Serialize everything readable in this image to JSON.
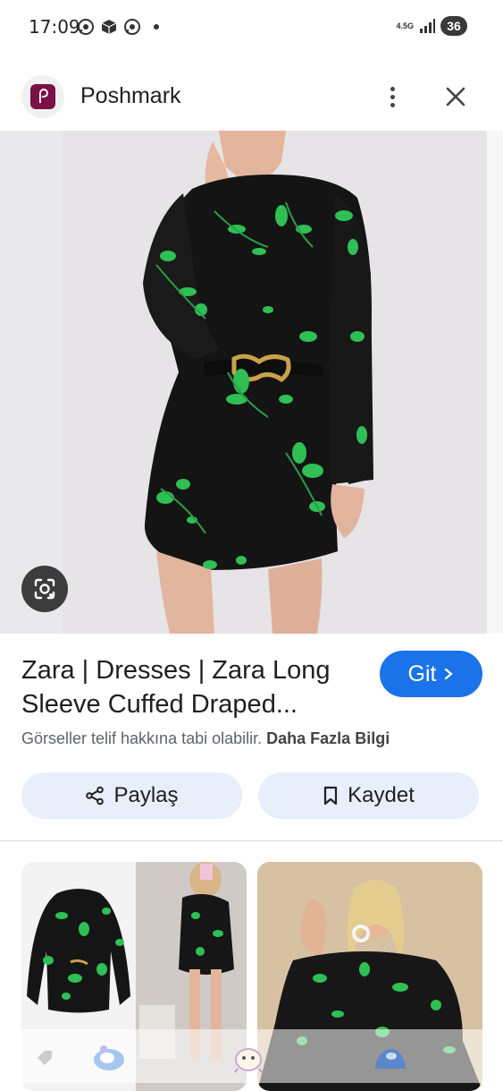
{
  "status_bar": {
    "time": "17:09",
    "network": "4.5G",
    "battery": "36"
  },
  "header": {
    "site_name": "Poshmark",
    "logo_letter": "P"
  },
  "result": {
    "title": "Zara | Dresses | Zara Long Sleeve Cuffed Draped...",
    "visit_label": "Git",
    "copyright_text": "Görseller telif hakkına tabi olabilir.",
    "more_info_label": "Daha Fazla Bilgi"
  },
  "actions": {
    "share_label": "Paylaş",
    "save_label": "Kaydet"
  },
  "icons": {
    "lens": "lens-icon",
    "share": "share-icon",
    "bookmark": "bookmark-icon",
    "more": "more-vert-icon",
    "close": "close-icon"
  },
  "colors": {
    "accent": "#1a73e8",
    "chip_bg": "#e8eefa",
    "logo_bg": "#7b1144"
  }
}
